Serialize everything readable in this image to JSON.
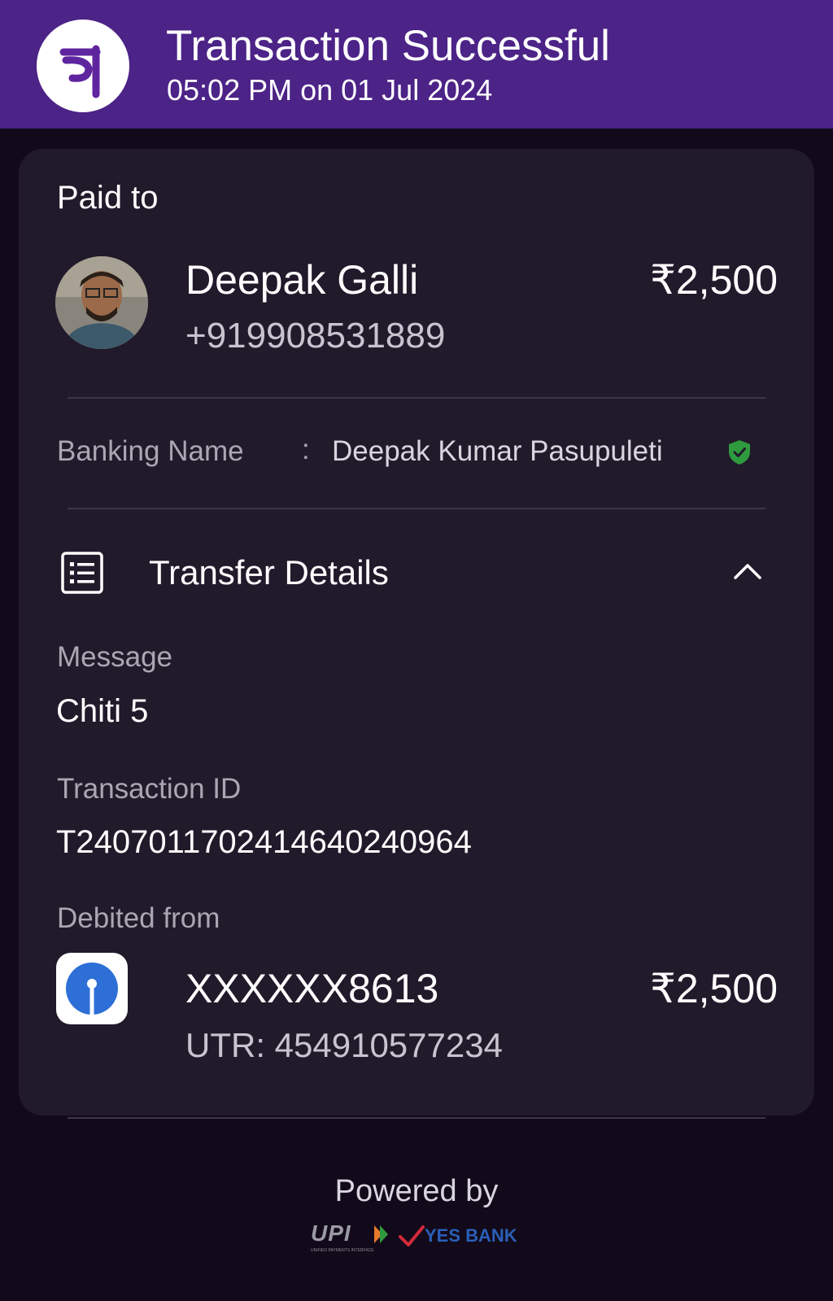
{
  "header": {
    "title": "Transaction Successful",
    "datetime": "05:02 PM on 01 Jul 2024",
    "logo_icon": "phonepe-logo",
    "logo_glyph": "पे"
  },
  "payee": {
    "section_label": "Paid to",
    "name": "Deepak Galli",
    "phone": "+919908531889",
    "amount": "₹2,500",
    "avatar_icon": "avatar"
  },
  "banking": {
    "label": "Banking Name",
    "separator": ":",
    "value": "Deepak Kumar Pasupuleti",
    "verified_icon": "verified-shield-icon"
  },
  "transfer_details": {
    "title": "Transfer Details",
    "expanded": true,
    "message_label": "Message",
    "message_value": "Chiti 5",
    "txn_id_label": "Transaction ID",
    "txn_id_value": "T2407011702414640240964",
    "debited_label": "Debited from",
    "account": "XXXXXX8613",
    "utr": "UTR: 454910577234",
    "debited_amount": "₹2,500"
  },
  "footer": {
    "powered_by": "Powered by",
    "upi_logo": "UPI",
    "upi_sub": "UNIFIED PAYMENTS INTERFACE",
    "bank_logo": "YES BANK"
  },
  "colors": {
    "header_bg": "#4c2387",
    "page_bg": "#120a1a",
    "card_bg": "#211a2b",
    "verified_green": "#2e9b3e",
    "sbi_blue": "#2d6fd6"
  }
}
